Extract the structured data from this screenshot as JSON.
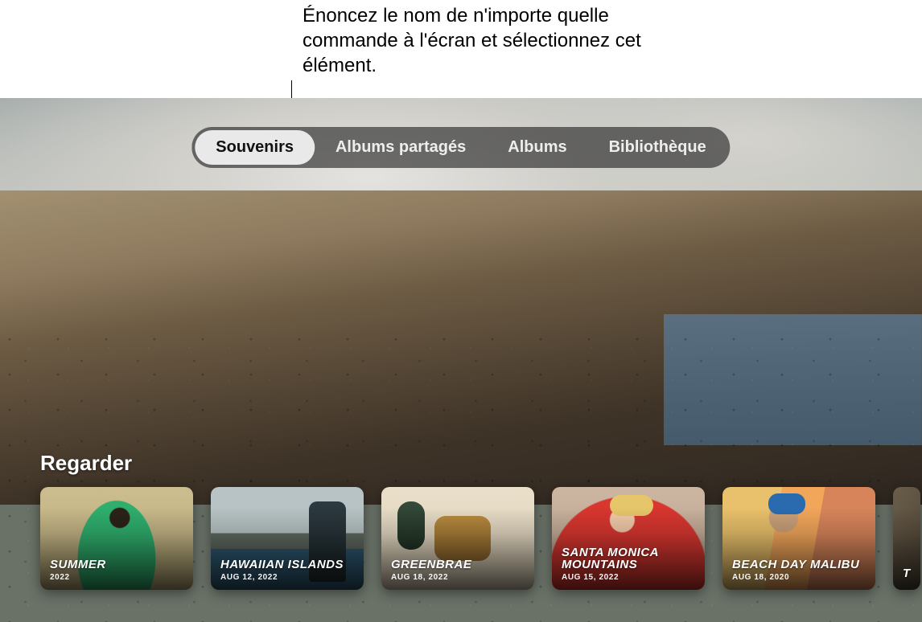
{
  "annotation": {
    "text": "Énoncez le nom de n'importe quelle commande à l'écran et sélectionnez cet élément."
  },
  "tabs": [
    {
      "label": "Souvenirs",
      "active": true
    },
    {
      "label": "Albums partagés",
      "active": false
    },
    {
      "label": "Albums",
      "active": false
    },
    {
      "label": "Bibliothèque",
      "active": false
    }
  ],
  "section": {
    "title": "Regarder"
  },
  "memories": [
    {
      "title": "SUMMER",
      "date": "2022"
    },
    {
      "title": "HAWAIIAN ISLANDS",
      "date": "AUG 12, 2022"
    },
    {
      "title": "GREENBRAE",
      "date": "AUG 18, 2022"
    },
    {
      "title": "SANTA MONICA MOUNTAINS",
      "date": "AUG 15, 2022"
    },
    {
      "title": "BEACH DAY MALIBU",
      "date": "AUG 18, 2020"
    },
    {
      "title": "T",
      "date": ""
    }
  ]
}
